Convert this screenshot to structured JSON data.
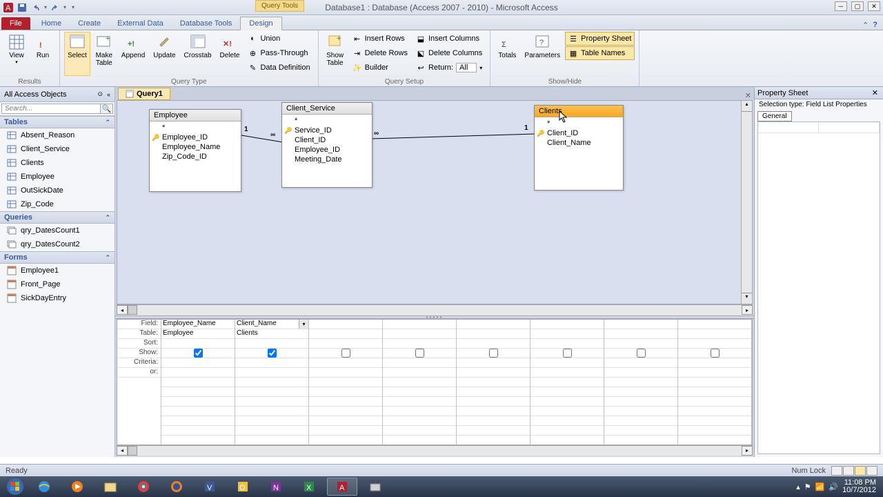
{
  "app": {
    "title": "Database1 : Database (Access 2007 - 2010)  -  Microsoft Access",
    "contextual_label": "Query Tools"
  },
  "tabs": {
    "file": "File",
    "home": "Home",
    "create": "Create",
    "external": "External Data",
    "dbtools": "Database Tools",
    "design": "Design"
  },
  "ribbon": {
    "results": {
      "group": "Results",
      "view": "View",
      "run": "Run"
    },
    "querytype": {
      "group": "Query Type",
      "select": "Select",
      "make": "Make\nTable",
      "append": "Append",
      "update": "Update",
      "crosstab": "Crosstab",
      "delete": "Delete",
      "union": "Union",
      "passthrough": "Pass-Through",
      "datadef": "Data Definition"
    },
    "setup": {
      "group": "Query Setup",
      "showtable": "Show\nTable",
      "insertrows": "Insert Rows",
      "deleterows": "Delete Rows",
      "builder": "Builder",
      "insertcols": "Insert Columns",
      "deletecols": "Delete Columns",
      "return": "Return:",
      "return_val": "All"
    },
    "showhide": {
      "group": "Show/Hide",
      "totals": "Totals",
      "parameters": "Parameters",
      "propsheet": "Property Sheet",
      "tablenames": "Table Names"
    }
  },
  "nav": {
    "header": "All Access Objects",
    "search_ph": "Search...",
    "tables_hdr": "Tables",
    "tables": [
      "Absent_Reason",
      "Client_Service",
      "Clients",
      "Employee",
      "OutSickDate",
      "Zip_Code"
    ],
    "queries_hdr": "Queries",
    "queries": [
      "qry_DatesCount1",
      "qry_DatesCount2"
    ],
    "forms_hdr": "Forms",
    "forms": [
      "Employee1",
      "Front_Page",
      "SickDayEntry"
    ]
  },
  "doc": {
    "tab_name": "Query1",
    "boxes": {
      "employee": {
        "title": "Employee",
        "fields_star": "*",
        "fields": [
          "Employee_ID",
          "Employee_Name",
          "Zip_Code_ID"
        ]
      },
      "client_service": {
        "title": "Client_Service",
        "fields_star": "*",
        "fields": [
          "Service_ID",
          "Client_ID",
          "Employee_ID",
          "Meeting_Date"
        ]
      },
      "clients": {
        "title": "Clients",
        "fields_star": "*",
        "fields": [
          "Client_ID",
          "Client_Name"
        ]
      }
    },
    "rel": {
      "one": "1",
      "many": "∞"
    }
  },
  "qbe": {
    "rows": {
      "field": "Field:",
      "table": "Table:",
      "sort": "Sort:",
      "show": "Show:",
      "criteria": "Criteria:",
      "or": "or:"
    },
    "cols": [
      {
        "field": "Employee_Name",
        "table": "Employee",
        "show": true
      },
      {
        "field": "Client_Name",
        "table": "Clients",
        "show": true,
        "dropdown": true
      }
    ]
  },
  "prop": {
    "title": "Property Sheet",
    "seltype": "Selection type:  Field List Properties",
    "tab_general": "General"
  },
  "status": {
    "ready": "Ready",
    "numlock": "Num Lock"
  },
  "taskbar": {
    "time": "11:08 PM",
    "date": "10/7/2012"
  }
}
